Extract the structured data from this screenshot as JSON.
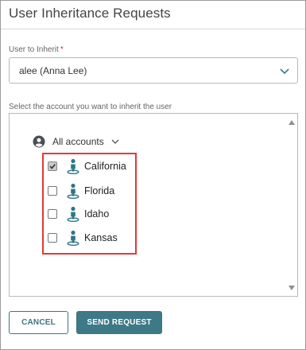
{
  "dialog": {
    "title": "User Inheritance Requests"
  },
  "user_field": {
    "label": "User to Inherit",
    "required_marker": "*",
    "value": "alee (Anna Lee)",
    "chevron_icon": "chevron-down-icon"
  },
  "accounts": {
    "label": "Select the account you want to inherit the user",
    "root": {
      "label": "All accounts",
      "icon": "user-circle-icon",
      "chevron_icon": "chevron-down-icon"
    },
    "items": [
      {
        "label": "California",
        "checked": true,
        "icon": "account-location-icon"
      },
      {
        "label": "Florida",
        "checked": false,
        "icon": "account-location-icon"
      },
      {
        "label": "Idaho",
        "checked": false,
        "icon": "account-location-icon"
      },
      {
        "label": "Kansas",
        "checked": false,
        "icon": "account-location-icon"
      }
    ]
  },
  "buttons": {
    "cancel": "CANCEL",
    "send": "SEND REQUEST"
  },
  "colors": {
    "accent": "#3d7986",
    "highlight": "#e03a3a",
    "required": "#d9342b",
    "icon_teal": "#2e7588"
  }
}
